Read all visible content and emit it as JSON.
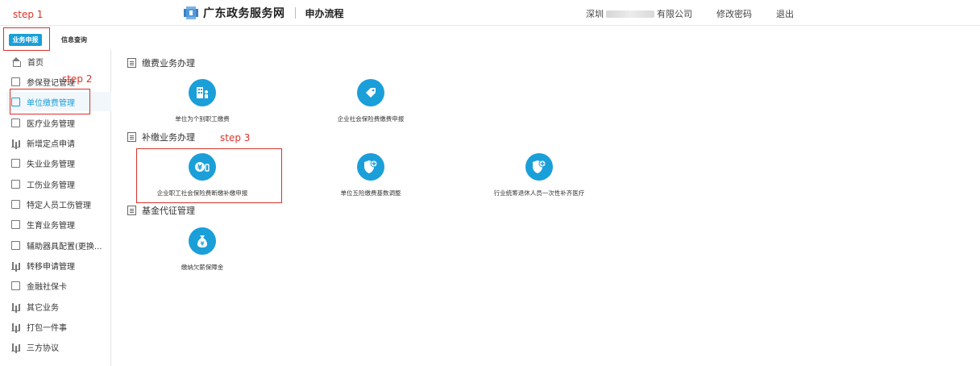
{
  "header": {
    "site_title": "广东政务服务网",
    "subtitle": "申办流程",
    "company_prefix": "深圳",
    "company_suffix": "有限公司",
    "change_password": "修改密码",
    "logout": "退出"
  },
  "tabs": {
    "active": "业务申报",
    "second": "信息查询"
  },
  "steps": {
    "step1": "step 1",
    "step2": "step 2",
    "step3": "step 3"
  },
  "sidebar": {
    "items": [
      {
        "label": "首页",
        "icon": "home-icon"
      },
      {
        "label": "参保登记管理",
        "icon": "document-icon"
      },
      {
        "label": "单位缴费管理",
        "icon": "document-icon"
      },
      {
        "label": "医疗业务管理",
        "icon": "document-icon"
      },
      {
        "label": "新增定点申请",
        "icon": "bar-chart-icon"
      },
      {
        "label": "失业业务管理",
        "icon": "document-icon"
      },
      {
        "label": "工伤业务管理",
        "icon": "document-icon"
      },
      {
        "label": "特定人员工伤管理",
        "icon": "document-icon"
      },
      {
        "label": "生育业务管理",
        "icon": "document-icon"
      },
      {
        "label": "辅助器具配置(更换...",
        "icon": "document-icon"
      },
      {
        "label": "转移申请管理",
        "icon": "bar-chart-icon"
      },
      {
        "label": "金融社保卡",
        "icon": "document-icon"
      },
      {
        "label": "其它业务",
        "icon": "bar-chart-icon"
      },
      {
        "label": "打包一件事",
        "icon": "bar-chart-icon"
      },
      {
        "label": "三方协议",
        "icon": "bar-chart-icon"
      }
    ]
  },
  "sections": [
    {
      "title": "缴费业务办理",
      "cards": [
        {
          "label": "单位为个别职工缴费",
          "icon": "building-icon"
        },
        {
          "label": "企业社会保险费缴费申报",
          "icon": "tag-icon"
        }
      ]
    },
    {
      "title": "补缴业务办理",
      "cards": [
        {
          "label": "企业职工社会保险费断缴补缴申报",
          "icon": "yen-coin-icon"
        },
        {
          "label": "单位五险缴费基数调整",
          "icon": "shield-plus-icon"
        },
        {
          "label": "行业统筹退休人员一次性补齐医疗",
          "icon": "shield-plus-icon"
        }
      ]
    },
    {
      "title": "基金代征管理",
      "cards": [
        {
          "label": "缴纳欠薪保障金",
          "icon": "money-bag-icon"
        }
      ]
    }
  ],
  "colors": {
    "accent": "#1a9fd9",
    "annotation": "#d8332b"
  }
}
